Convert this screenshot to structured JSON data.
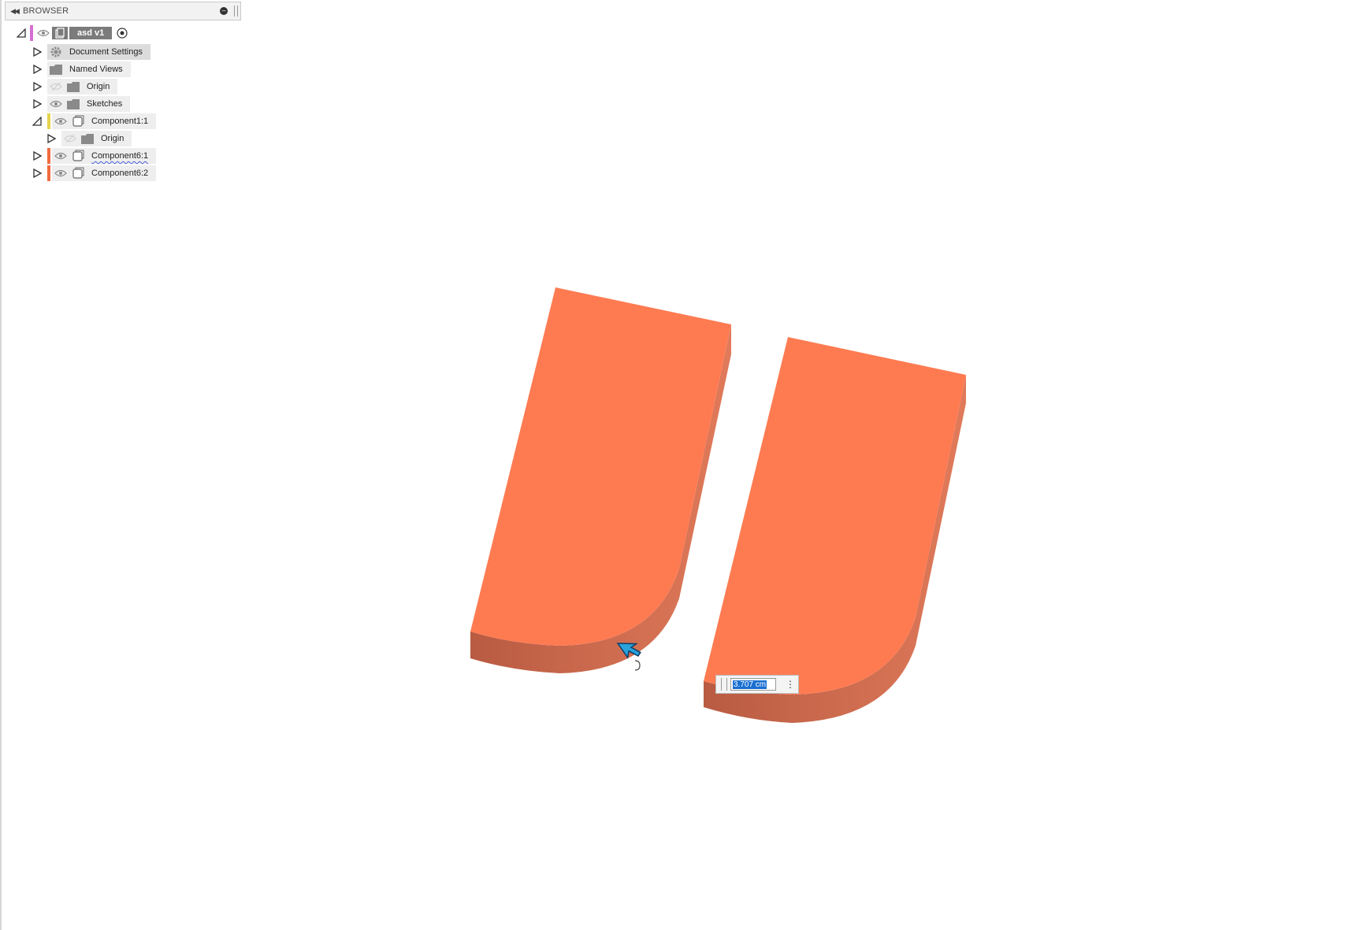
{
  "browser": {
    "title": "BROWSER",
    "root": {
      "label": "asd v1"
    },
    "items": [
      {
        "label": "Document Settings"
      },
      {
        "label": "Named Views"
      },
      {
        "label": "Origin"
      },
      {
        "label": "Sketches"
      },
      {
        "label": "Component1:1"
      },
      {
        "label": "Origin"
      },
      {
        "label": "Component6:1"
      },
      {
        "label": "Component6:2"
      }
    ]
  },
  "dimension": {
    "value": "3.707 cm"
  },
  "colors": {
    "body_face": "#fe7b52",
    "body_side": "#d9694a",
    "component_bar": "#f26a3d",
    "component1_bar": "#e6d44a",
    "root_bar": "#d46fd3"
  }
}
